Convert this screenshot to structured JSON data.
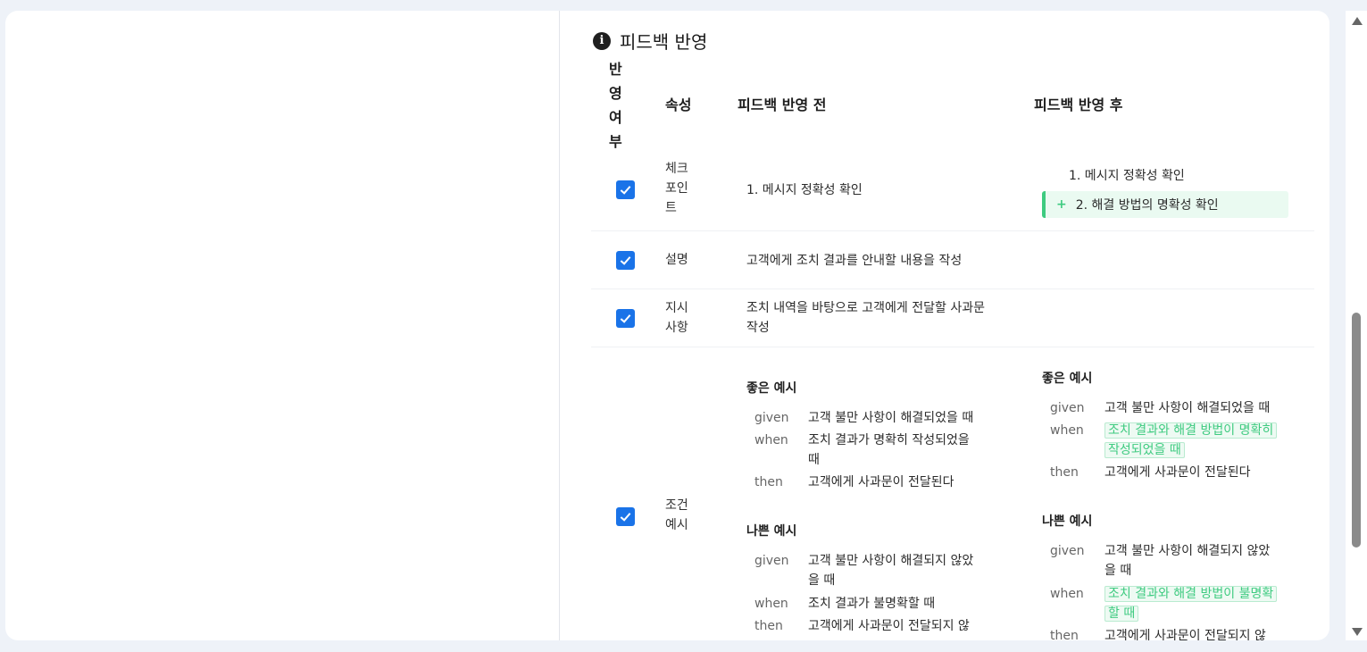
{
  "section": {
    "title": "피드백 반영"
  },
  "table": {
    "headers": {
      "applied": "반\n영\n여\n부",
      "attribute": "속성",
      "before": "피드백 반영 전",
      "after": "피드백 반영 후"
    },
    "rows": [
      {
        "attribute": "체크\n포인\n트",
        "before": "1. 메시지 정확성 확인",
        "after": "1. 메시지 정확성 확인",
        "added": "2. 해결 방법의 명확성 확인"
      },
      {
        "attribute": "설명",
        "before": "고객에게 조치 결과를 안내할 내용을 작성"
      },
      {
        "attribute": "지시\n사항",
        "before": "조치 내역을 바탕으로 고객에게 전달할 사과문 작성"
      },
      {
        "attribute": "조건\n예시"
      }
    ]
  },
  "examples": {
    "before": {
      "good": {
        "title": "좋은 예시",
        "given_kw": "given",
        "given": "고객 불만 사항이 해결되었을 때",
        "when_kw": "when",
        "when": "조치 결과가 명확히 작성되었을 때",
        "then_kw": "then",
        "then": "고객에게 사과문이 전달된다"
      },
      "bad": {
        "title": "나쁜 예시",
        "given_kw": "given",
        "given": "고객 불만 사항이 해결되지 않았을 때",
        "when_kw": "when",
        "when": "조치 결과가 불명확할 때",
        "then_kw": "then",
        "then": "고객에게 사과문이 전달되지 않"
      }
    },
    "after": {
      "good": {
        "title": "좋은 예시",
        "given_kw": "given",
        "given": "고객 불만 사항이 해결되었을 때",
        "when_kw": "when",
        "when": "조치 결과와 해결 방법이 명확히 작성되었을 때",
        "then_kw": "then",
        "then": "고객에게 사과문이 전달된다"
      },
      "bad": {
        "title": "나쁜 예시",
        "given_kw": "given",
        "given": "고객 불만 사항이 해결되지 않았을 때",
        "when_kw": "when",
        "when": "조치 결과와 해결 방법이 불명확할 때",
        "then_kw": "then",
        "then": "고객에게 사과문이 전달되지 않"
      }
    }
  },
  "colors": {
    "checkbox": "#1a73e8",
    "added": "#3ecb80"
  }
}
